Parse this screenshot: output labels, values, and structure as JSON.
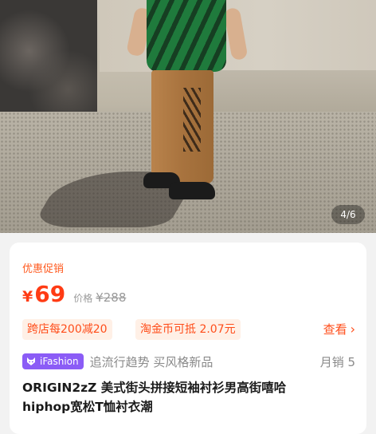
{
  "gallery": {
    "counter": "4/6"
  },
  "promo": {
    "label": "优惠促销",
    "currency": "¥",
    "price": "69",
    "orig_label": "价格",
    "orig_price": "¥288"
  },
  "coupons": {
    "tag1": "跨店每200减20",
    "tag2": "淘金币可抵 2.07元",
    "view_more": "查看",
    "view_more_icon": "chevron-right-icon"
  },
  "brand": {
    "badge": "iFashion",
    "badge_icon": "fox-icon",
    "badge_color": "#8b5cf6",
    "slogan": "追流行趋势 买风格新品",
    "sales": "月销 5"
  },
  "product": {
    "title_line1": "ORIGIN2zZ 美式街头拼接短袖衬衫男高街嘻哈",
    "title_line2": "hiphop宽松T恤衬衣潮"
  },
  "colors": {
    "accent": "#ff3b14",
    "tag_bg": "#fff0e6"
  }
}
